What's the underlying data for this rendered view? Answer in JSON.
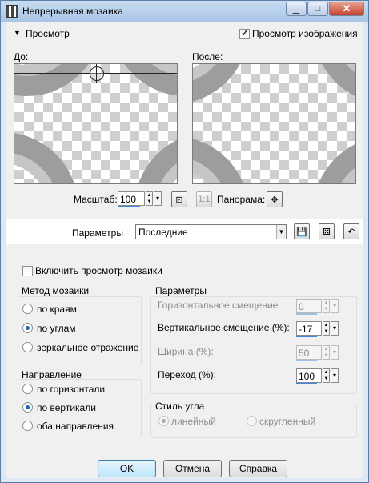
{
  "window": {
    "title": "Непрерывная мозаика"
  },
  "preview_header": {
    "collapse_label": "Просмотр",
    "show_preview_label": "Просмотр изображения",
    "show_preview_checked": true
  },
  "previews": {
    "before_label": "До:",
    "after_label": "После:"
  },
  "zoom": {
    "label": "Масштаб:",
    "value": "100",
    "pan_label": "Панорама:"
  },
  "presets": {
    "label": "Параметры",
    "value": "Последние"
  },
  "tile_preview": {
    "label": "Включить просмотр мозаики",
    "checked": false
  },
  "method": {
    "title": "Метод мозаики",
    "options": [
      "по краям",
      "по углам",
      "зеркальное отражение"
    ],
    "selected": 1
  },
  "direction": {
    "title": "Направление",
    "options": [
      "по горизонтали",
      "по вертикали",
      "оба направления"
    ],
    "selected": 1
  },
  "params": {
    "title": "Параметры",
    "h_offset": {
      "label": "Горизонтальное смещение",
      "value": "0",
      "enabled": false
    },
    "v_offset": {
      "label": "Вертикальное смещение (%):",
      "value": "-17",
      "enabled": true
    },
    "width": {
      "label": "Ширина (%):",
      "value": "50",
      "enabled": false
    },
    "transition": {
      "label": "Переход (%):",
      "value": "100",
      "enabled": true
    }
  },
  "corner_style": {
    "title": "Стиль угла",
    "options": [
      "линейный",
      "скругленный"
    ],
    "selected": 0,
    "enabled": false
  },
  "buttons": {
    "ok": "OK",
    "cancel": "Отмена",
    "help": "Справка"
  }
}
